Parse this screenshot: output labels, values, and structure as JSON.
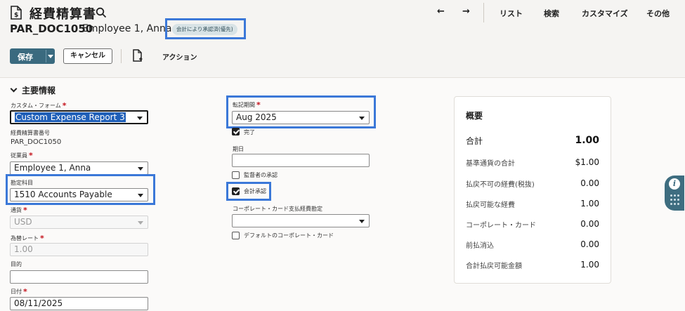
{
  "header": {
    "page_title": "経費精算書",
    "doc_id": "PAR_DOC1050",
    "employee_name": "Employee 1, Anna",
    "status_badge": "会計により承認済(優先)"
  },
  "nav": {
    "back_arrow": "←",
    "forward_arrow": "→",
    "list": "リスト",
    "search": "検索",
    "customize": "カスタマイズ",
    "other": "その他"
  },
  "toolbar": {
    "save_label": "保存",
    "cancel_label": "キャンセル",
    "action_label": "アクション"
  },
  "section": {
    "title": "主要情報"
  },
  "form_left": {
    "custom_form_label": "カスタム・フォーム",
    "custom_form_value": "Custom Expense Report 3",
    "report_number_label": "経費精算書番号",
    "report_number_value": "PAR_DOC1050",
    "employee_label": "従業員",
    "employee_value": "Employee 1, Anna",
    "account_label": "勘定科目",
    "account_value": "1510 Accounts Payable",
    "currency_label": "通貨",
    "currency_value": "USD",
    "exchange_rate_label": "為替レート",
    "exchange_rate_value": "1.00",
    "purpose_label": "目的",
    "purpose_value": "",
    "date_label": "日付",
    "date_value": "08/11/2025"
  },
  "form_mid": {
    "posting_period_label": "転記期間",
    "posting_period_value": "Aug 2025",
    "complete_label": "完了",
    "due_date_label": "期日",
    "due_date_value": "",
    "supervisor_approval_label": "監督者の承認",
    "accounting_approval_label": "会計承認",
    "corp_card_account_label": "コーポレート・カード支払経費勘定",
    "corp_card_account_value": "",
    "default_corp_card_label": "デフォルトのコーポレート・カード"
  },
  "checkboxes": {
    "complete": true,
    "supervisor_approval": false,
    "accounting_approval": true,
    "default_corp_card": false
  },
  "summary": {
    "title": "概要",
    "rows": [
      {
        "label": "合計",
        "value": "1.00"
      },
      {
        "label": "基準通貨の合計",
        "value": "$1.00"
      },
      {
        "label": "払戻不可の経費(税抜)",
        "value": "0.00"
      },
      {
        "label": "払戻可能な経費",
        "value": "1.00"
      },
      {
        "label": "コーポレート・カード",
        "value": "0.00"
      },
      {
        "label": "前払消込",
        "value": "0.00"
      },
      {
        "label": "合計払戻可能金額",
        "value": "1.00"
      }
    ]
  },
  "help": {
    "info_glyph": "i"
  },
  "colors": {
    "primary_button": "#3a6a7f",
    "highlight_box": "#3b78d8",
    "required_mark": "#c4111b",
    "status_badge_bg": "#d8e3e6"
  }
}
